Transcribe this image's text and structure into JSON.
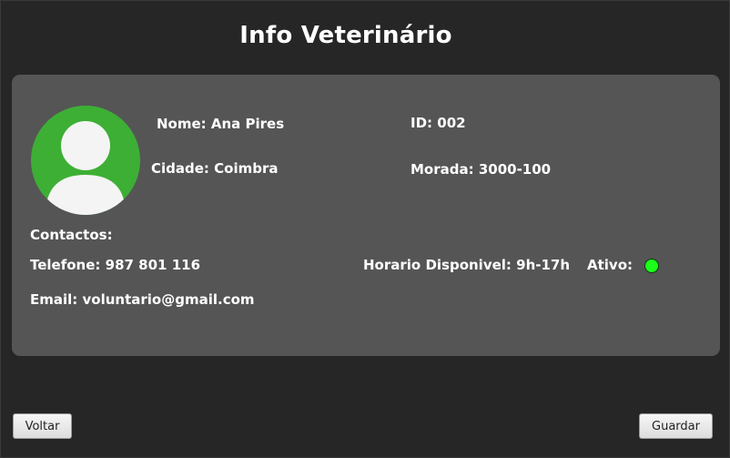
{
  "page": {
    "title": "Info Veterinário"
  },
  "profile": {
    "avatar_icon": "user-avatar-icon",
    "name_label": "Nome: Ana Pires",
    "id_label": "ID: 002",
    "city_label": "Cidade: Coimbra",
    "address_label": "Morada: 3000-100",
    "contacts_heading": "Contactos:",
    "phone_label": "Telefone: 987 801 116",
    "schedule_label": "Horario Disponivel: 9h-17h",
    "active_label": "Ativo:",
    "active_status_color": "#1bff1b",
    "email_label": "Email: voluntario@gmail.com"
  },
  "actions": {
    "back_label": "Voltar",
    "save_label": "Guardar"
  },
  "colors": {
    "background": "#262626",
    "card": "#555555",
    "avatar_bg": "#3daf35"
  }
}
